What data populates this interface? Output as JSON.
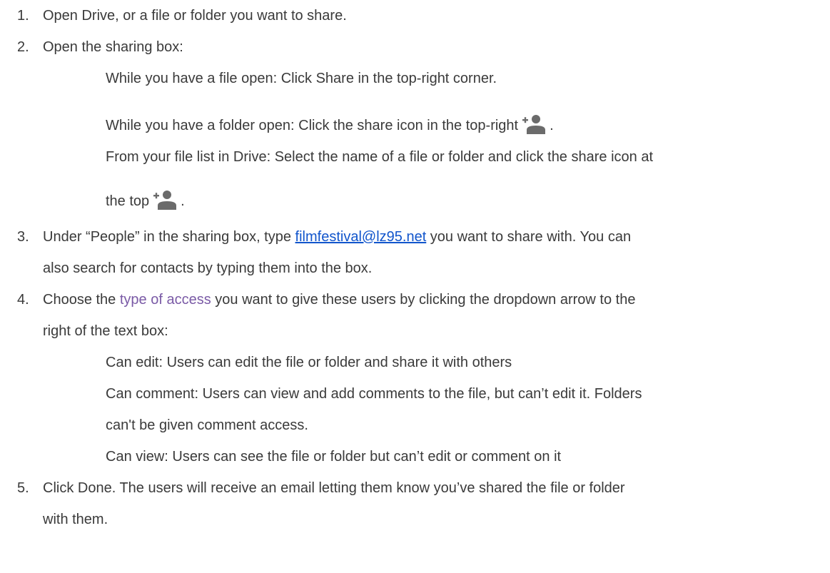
{
  "steps": {
    "s1": {
      "number": "1.",
      "text": "Open Drive, or a file or folder you want to share."
    },
    "s2": {
      "number": "2.",
      "text": "Open the sharing box:",
      "sub1": "While you have a file open: Click Share in the top-right corner.",
      "sub2": "While you have a folder open: Click the share icon in the top-right",
      "sub2_end": ".",
      "sub3_a": "From your file list in Drive: Select the name of a file or folder and click the share icon at",
      "sub3_b": "the top",
      "sub3_end": "."
    },
    "s3": {
      "number": "3.",
      "text_before": "Under “People” in the sharing box, type ",
      "link": "filmfestival@lz95.net",
      "text_after": " you want to share with. You can",
      "line2": "also search for contacts by typing them into the box."
    },
    "s4": {
      "number": "4.",
      "text_before": "Choose the ",
      "link": "type of access",
      "text_after": " you want to give these users by clicking the dropdown arrow to the",
      "line2": "right of the text box:",
      "opt1": "Can edit: Users can edit the file or folder and share it with others",
      "opt2_a": "Can comment:  Users can view and add comments to the file, but can’t edit it. Folders",
      "opt2_b": "can't be given comment access.",
      "opt3": "Can view:  Users can see the file or folder but can’t edit or comment on it"
    },
    "s5": {
      "number": "5.",
      "text": "Click Done. The users will receive an email letting them know you’ve shared the file or folder",
      "line2": "with them."
    }
  },
  "colors": {
    "text": "#3a3a3a",
    "link": "#1155cc",
    "accent": "#7a5aa6",
    "icon": "#6b6b6b"
  },
  "icons": {
    "share": "add-person-icon"
  }
}
